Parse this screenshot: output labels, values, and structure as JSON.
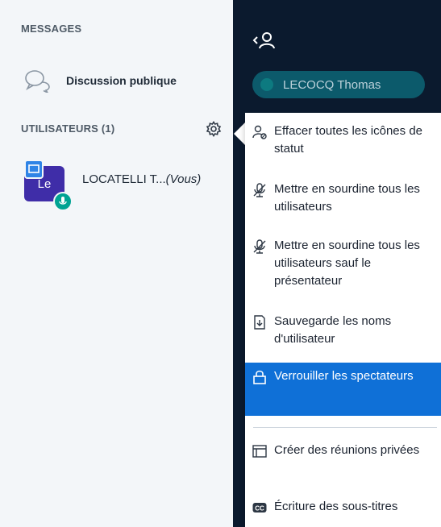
{
  "sidebar": {
    "messages_title": "MESSAGES",
    "public_chat_label": "Discussion publique",
    "users_title": "UTILISATEURS (1)",
    "users": [
      {
        "avatar_initials": "Le",
        "name": "LOCATELLI T...",
        "you_suffix": "(Vous)"
      }
    ]
  },
  "panel": {
    "presenter_name": "LECOCQ Thomas"
  },
  "menu": {
    "items": [
      {
        "label": "Effacer toutes les icônes de statut",
        "icon": "clear-status-icon"
      },
      {
        "label": "Mettre en sourdine tous les utilisateurs",
        "icon": "mute-icon"
      },
      {
        "label": "Mettre en sourdine tous les utilisateurs sauf le présentateur",
        "icon": "mute-icon"
      },
      {
        "label": "Sauvegarde les noms d'utilisateur",
        "icon": "download-icon"
      },
      {
        "label": "Verrouiller les spectateurs",
        "icon": "lock-icon",
        "active": true
      },
      {
        "label": "Créer des réunions privées",
        "icon": "breakout-icon"
      },
      {
        "label": "Écriture des sous-titres",
        "icon": "closed-caption-icon"
      }
    ]
  },
  "colors": {
    "accent": "#0f70d7",
    "dark_panel": "#0b1a2e",
    "avatar": "#3f2da8",
    "mic_badge": "#00a393"
  }
}
